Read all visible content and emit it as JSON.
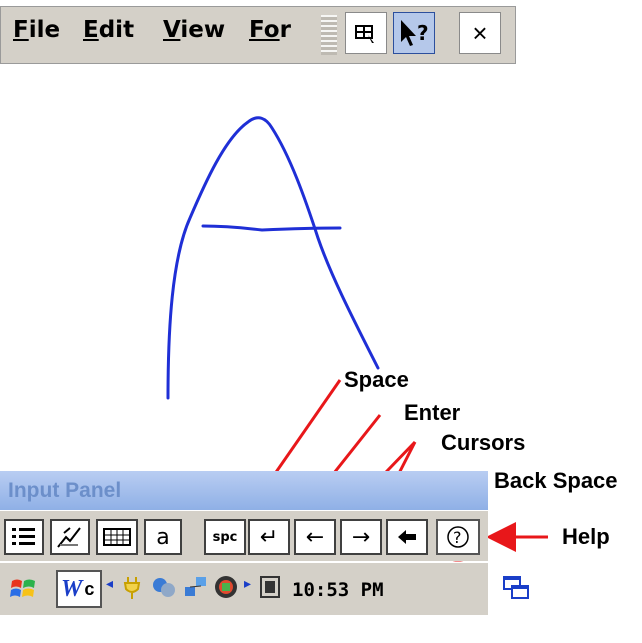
{
  "menu": {
    "items": [
      {
        "label": "File",
        "ul": "F",
        "rest": "ile"
      },
      {
        "label": "Edit",
        "ul": "E",
        "rest": "dit"
      },
      {
        "label": "View",
        "ul": "V",
        "rest": "iew"
      },
      {
        "label": "For",
        "ul": "Fo",
        "rest": "r"
      }
    ],
    "help_icon_text": "?",
    "close_text": "×"
  },
  "callouts": {
    "space": "Space",
    "enter": "Enter",
    "cursors": "Cursors",
    "backspace": "Back Space",
    "help": "Help"
  },
  "input_panel": {
    "title": "Input Panel",
    "keys": {
      "spc": "spc",
      "a": "a",
      "enter": "↵",
      "left": "←",
      "right": "→",
      "backspace": "◆",
      "help": "?"
    }
  },
  "taskbar": {
    "time": "10:53 PM",
    "word_app_text": "c"
  },
  "colors": {
    "ink": "#1f2fd6",
    "callout_arrow": "#e8171a",
    "panel_gray": "#d4d0c8"
  }
}
